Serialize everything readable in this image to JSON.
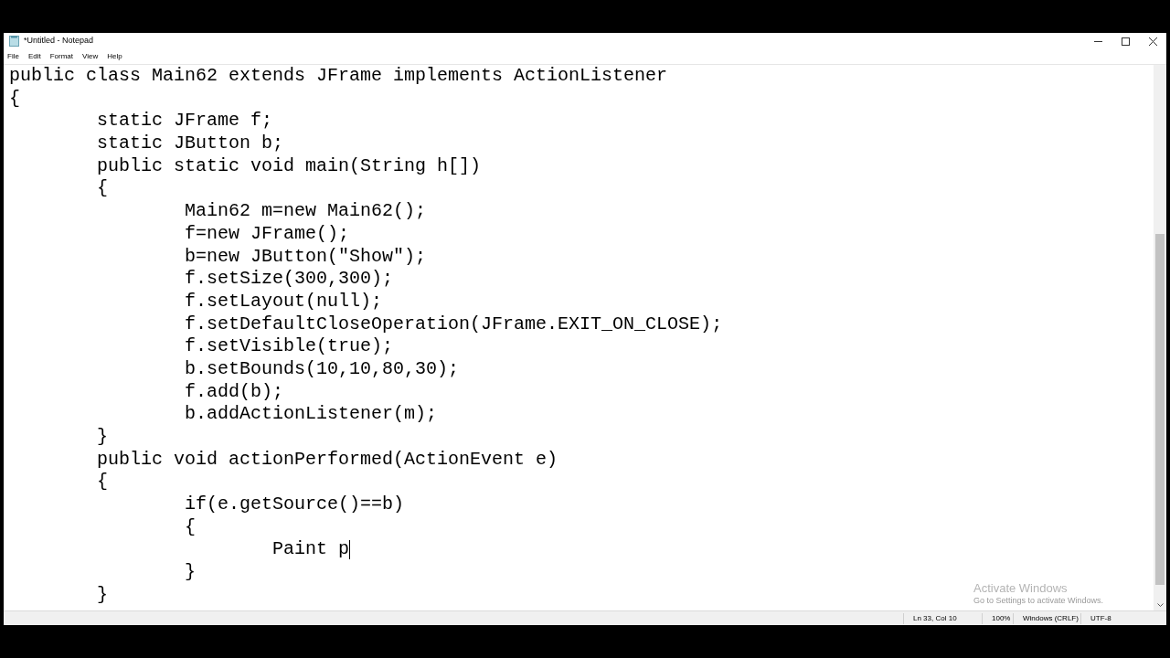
{
  "window": {
    "title": "*Untitled - Notepad"
  },
  "menu": [
    "File",
    "Edit",
    "Format",
    "View",
    "Help"
  ],
  "editor": {
    "lines": [
      {
        "text": "public class Main62 extends JFrame implements ActionListener",
        "caret": false
      },
      {
        "text": "{",
        "caret": false
      },
      {
        "text": "\tstatic JFrame f;",
        "caret": false
      },
      {
        "text": "\tstatic JButton b;",
        "caret": false
      },
      {
        "text": "\tpublic static void main(String h[])",
        "caret": false
      },
      {
        "text": "\t{",
        "caret": false
      },
      {
        "text": "\t\tMain62 m=new Main62();",
        "caret": false
      },
      {
        "text": "\t\tf=new JFrame();",
        "caret": false
      },
      {
        "text": "\t\tb=new JButton(\"Show\");",
        "caret": false
      },
      {
        "text": "\t\tf.setSize(300,300);",
        "caret": false
      },
      {
        "text": "\t\tf.setLayout(null);",
        "caret": false
      },
      {
        "text": "\t\tf.setDefaultCloseOperation(JFrame.EXIT_ON_CLOSE);",
        "caret": false
      },
      {
        "text": "\t\tf.setVisible(true);",
        "caret": false
      },
      {
        "text": "\t\tb.setBounds(10,10,80,30);",
        "caret": false
      },
      {
        "text": "\t\tf.add(b);",
        "caret": false
      },
      {
        "text": "\t\tb.addActionListener(m);",
        "caret": false
      },
      {
        "text": "\t}",
        "caret": false
      },
      {
        "text": "\tpublic void actionPerformed(ActionEvent e)",
        "caret": false
      },
      {
        "text": "\t{",
        "caret": false
      },
      {
        "text": "\t\tif(e.getSource()==b)",
        "caret": false
      },
      {
        "text": "\t\t{",
        "caret": false
      },
      {
        "text": "\t\t\tPaint p",
        "caret": true
      },
      {
        "text": "\t\t}",
        "caret": false
      },
      {
        "text": "\t}",
        "caret": false
      }
    ]
  },
  "activation_notice": {
    "title": "Activate Windows",
    "message": "Go to Settings to activate Windows."
  },
  "status_bar": [
    "Ln 33, Col 10",
    "100%",
    "Windows (CRLF)",
    "UTF-8"
  ]
}
